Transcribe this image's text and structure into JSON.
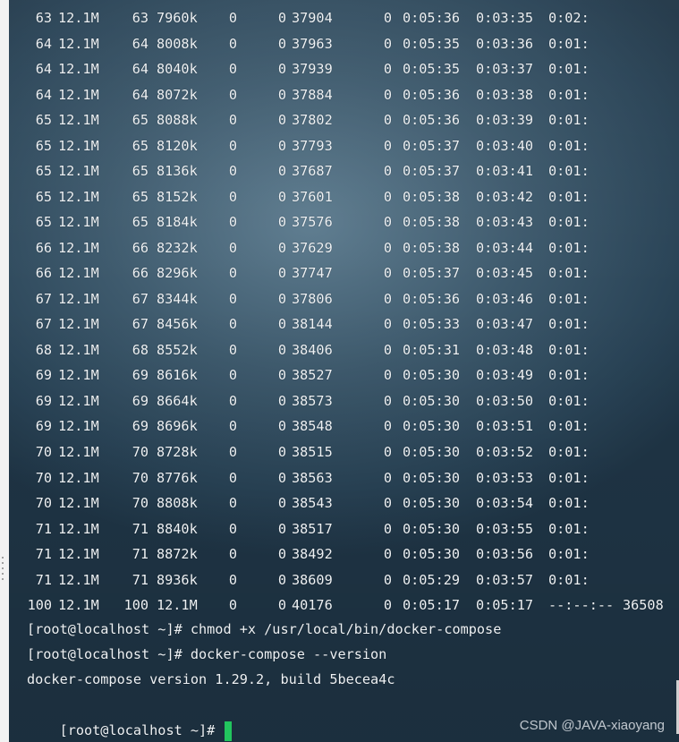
{
  "window": {
    "watermark": "CSDN @JAVA-xiaoyang"
  },
  "progress_rows": [
    [
      "63",
      "12.1M",
      "63",
      "7960k",
      "0",
      "0",
      "37904",
      "0",
      "0:05:36",
      "0:03:35",
      "0:02:"
    ],
    [
      "64",
      "12.1M",
      "64",
      "8008k",
      "0",
      "0",
      "37963",
      "0",
      "0:05:35",
      "0:03:36",
      "0:01:"
    ],
    [
      "64",
      "12.1M",
      "64",
      "8040k",
      "0",
      "0",
      "37939",
      "0",
      "0:05:35",
      "0:03:37",
      "0:01:"
    ],
    [
      "64",
      "12.1M",
      "64",
      "8072k",
      "0",
      "0",
      "37884",
      "0",
      "0:05:36",
      "0:03:38",
      "0:01:"
    ],
    [
      "65",
      "12.1M",
      "65",
      "8088k",
      "0",
      "0",
      "37802",
      "0",
      "0:05:36",
      "0:03:39",
      "0:01:"
    ],
    [
      "65",
      "12.1M",
      "65",
      "8120k",
      "0",
      "0",
      "37793",
      "0",
      "0:05:37",
      "0:03:40",
      "0:01:"
    ],
    [
      "65",
      "12.1M",
      "65",
      "8136k",
      "0",
      "0",
      "37687",
      "0",
      "0:05:37",
      "0:03:41",
      "0:01:"
    ],
    [
      "65",
      "12.1M",
      "65",
      "8152k",
      "0",
      "0",
      "37601",
      "0",
      "0:05:38",
      "0:03:42",
      "0:01:"
    ],
    [
      "65",
      "12.1M",
      "65",
      "8184k",
      "0",
      "0",
      "37576",
      "0",
      "0:05:38",
      "0:03:43",
      "0:01:"
    ],
    [
      "66",
      "12.1M",
      "66",
      "8232k",
      "0",
      "0",
      "37629",
      "0",
      "0:05:38",
      "0:03:44",
      "0:01:"
    ],
    [
      "66",
      "12.1M",
      "66",
      "8296k",
      "0",
      "0",
      "37747",
      "0",
      "0:05:37",
      "0:03:45",
      "0:01:"
    ],
    [
      "67",
      "12.1M",
      "67",
      "8344k",
      "0",
      "0",
      "37806",
      "0",
      "0:05:36",
      "0:03:46",
      "0:01:"
    ],
    [
      "67",
      "12.1M",
      "67",
      "8456k",
      "0",
      "0",
      "38144",
      "0",
      "0:05:33",
      "0:03:47",
      "0:01:"
    ],
    [
      "68",
      "12.1M",
      "68",
      "8552k",
      "0",
      "0",
      "38406",
      "0",
      "0:05:31",
      "0:03:48",
      "0:01:"
    ],
    [
      "69",
      "12.1M",
      "69",
      "8616k",
      "0",
      "0",
      "38527",
      "0",
      "0:05:30",
      "0:03:49",
      "0:01:"
    ],
    [
      "69",
      "12.1M",
      "69",
      "8664k",
      "0",
      "0",
      "38573",
      "0",
      "0:05:30",
      "0:03:50",
      "0:01:"
    ],
    [
      "69",
      "12.1M",
      "69",
      "8696k",
      "0",
      "0",
      "38548",
      "0",
      "0:05:30",
      "0:03:51",
      "0:01:"
    ],
    [
      "70",
      "12.1M",
      "70",
      "8728k",
      "0",
      "0",
      "38515",
      "0",
      "0:05:30",
      "0:03:52",
      "0:01:"
    ],
    [
      "70",
      "12.1M",
      "70",
      "8776k",
      "0",
      "0",
      "38563",
      "0",
      "0:05:30",
      "0:03:53",
      "0:01:"
    ],
    [
      "70",
      "12.1M",
      "70",
      "8808k",
      "0",
      "0",
      "38543",
      "0",
      "0:05:30",
      "0:03:54",
      "0:01:"
    ],
    [
      "71",
      "12.1M",
      "71",
      "8840k",
      "0",
      "0",
      "38517",
      "0",
      "0:05:30",
      "0:03:55",
      "0:01:"
    ],
    [
      "71",
      "12.1M",
      "71",
      "8872k",
      "0",
      "0",
      "38492",
      "0",
      "0:05:30",
      "0:03:56",
      "0:01:"
    ],
    [
      "71",
      "12.1M",
      "71",
      "8936k",
      "0",
      "0",
      "38609",
      "0",
      "0:05:29",
      "0:03:57",
      "0:01:"
    ],
    [
      "100",
      "12.1M",
      "100",
      "12.1M",
      "0",
      "0",
      "40176",
      "0",
      "0:05:17",
      "0:05:17",
      "--:--:--",
      "36508"
    ]
  ],
  "command_lines": [
    "[root@localhost ~]# chmod +x /usr/local/bin/docker-compose",
    "[root@localhost ~]# docker-compose --version",
    "docker-compose version 1.29.2, build 5becea4c"
  ],
  "prompt": "[root@localhost ~]# ",
  "colors": {
    "cursor": "#22c55e",
    "text": "#eef2f5"
  }
}
